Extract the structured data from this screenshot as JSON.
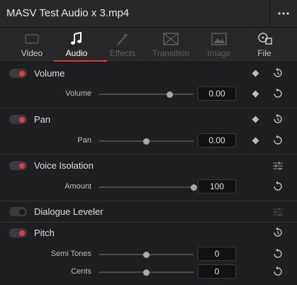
{
  "window": {
    "title": "MASV Test Audio x 3.mp4"
  },
  "tabs": [
    {
      "label": "Video",
      "icon": "video-icon",
      "state": "normal"
    },
    {
      "label": "Audio",
      "icon": "music-note-icon",
      "state": "active"
    },
    {
      "label": "Effects",
      "icon": "magic-wand-icon",
      "state": "disabled"
    },
    {
      "label": "Transition",
      "icon": "transition-icon",
      "state": "disabled"
    },
    {
      "label": "Image",
      "icon": "image-icon",
      "state": "disabled"
    },
    {
      "label": "File",
      "icon": "film-reel-icon",
      "state": "normal"
    }
  ],
  "sections": {
    "volume": {
      "label": "Volume",
      "enabled": true,
      "param_label": "Volume",
      "value": "0.00",
      "slider_fraction": 0.75
    },
    "pan": {
      "label": "Pan",
      "enabled": true,
      "param_label": "Pan",
      "value": "0.00",
      "slider_fraction": 0.5
    },
    "voice_isolation": {
      "label": "Voice Isolation",
      "enabled": true,
      "param_label": "Amount",
      "value": "100",
      "slider_fraction": 1.0
    },
    "dialogue_leveler": {
      "label": "Dialogue Leveler",
      "enabled": false
    },
    "pitch": {
      "label": "Pitch",
      "enabled": true,
      "semi_tones": {
        "label": "Semi Tones",
        "value": "0",
        "slider_fraction": 0.5
      },
      "cents": {
        "label": "Cents",
        "value": "0",
        "slider_fraction": 0.5
      }
    }
  },
  "colors": {
    "accent": "#e4373c",
    "toggle_on": "#e9393f",
    "background": "#1f1f21",
    "panel": "#28282a"
  }
}
